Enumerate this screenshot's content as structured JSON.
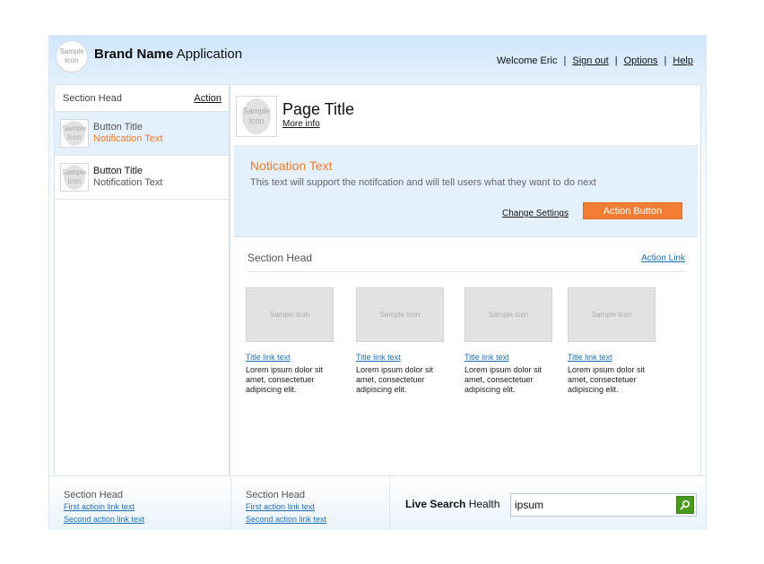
{
  "header": {
    "logo_text": "Sample Icon",
    "brand_bold": "Brand Name",
    "brand_rest": " Application",
    "nav": {
      "welcome": "Welcome Eric",
      "sign_out": "Sign out",
      "options": "Options",
      "help": "Help",
      "separator": "|"
    }
  },
  "sidebar": {
    "head": "Section Head",
    "action": "Action",
    "items": [
      {
        "icon_text": "Sample Icon",
        "title": "Button Title",
        "subtitle": "Notification Text",
        "selected": true
      },
      {
        "icon_text": "Sample Icon",
        "title": "Button Title",
        "subtitle": "Notification Text",
        "selected": false
      }
    ]
  },
  "main": {
    "icon_text": "Sample Icon",
    "page_title": "Page Title",
    "more_info": "More info",
    "notification": {
      "title": "Notication Text",
      "body": "This text will support the notifcation and will tell users what they want to do next",
      "change_settings": "Change Settings",
      "action_button": "Action Button"
    },
    "section": {
      "head": "Section Head",
      "action_link": "Action Link",
      "cards": [
        {
          "thumb_text": "Sample Icon",
          "link": "Title link text",
          "desc": "Lorem ipsum dolor sit amet, consectetuer adipiscing elit."
        },
        {
          "thumb_text": "Sample Icon",
          "link": "Title link text",
          "desc": "Lorem ipsum dolor sit amet, consectetuer adipiscing elit."
        },
        {
          "thumb_text": "Sample Icon",
          "link": "Title link text",
          "desc": "Lorem ipsum dolor sit amet, consectetuer adipiscing elit."
        },
        {
          "thumb_text": "Sample Icon",
          "link": "Title link text",
          "desc": "Lorem ipsum dolor sit amet, consectetuer adipiscing elit."
        }
      ]
    }
  },
  "footer": {
    "col1": {
      "head": "Section Head",
      "link1": "First actioin link text",
      "link2": "Second action link text"
    },
    "col2": {
      "head": "Section Head",
      "link1": "First action link text",
      "link2": "Second action link text"
    },
    "search": {
      "label_bold": "Live Search",
      "label_rest": " Health",
      "value": "ipsum",
      "button_icon": "search-icon"
    }
  },
  "colors": {
    "accent_orange": "#f37d33",
    "link_blue": "#1c6fb8",
    "search_green": "#4a9a1e",
    "highlight_blue": "#e4f0fb"
  }
}
